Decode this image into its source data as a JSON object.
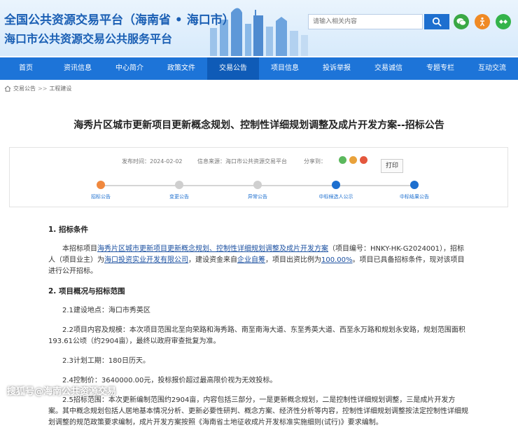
{
  "header": {
    "title_line1": "全国公共资源交易平台（海南省 • 海口市）",
    "title_line2": "海口市公共资源交易公共服务平台",
    "search_placeholder": "请输入相关内容"
  },
  "nav": {
    "items": [
      "首页",
      "资讯信息",
      "中心简介",
      "政策文件",
      "交易公告",
      "项目信息",
      "投诉举报",
      "交易诚信",
      "专题专栏",
      "互动交流"
    ],
    "active_index": 4
  },
  "breadcrumb": {
    "items": [
      "交易公告",
      "工程建设"
    ],
    "separator": ">>"
  },
  "article": {
    "title": "海秀片区城市更新项目更新概念规划、控制性详细规划调整及成片开发方案--招标公告",
    "publish_label": "发布时间：",
    "publish_date": "2024-02-02",
    "source_label": "信息来源：",
    "source": "海口市公共资源交易平台",
    "share_label": "分享到：",
    "print_label": "打印"
  },
  "progress": {
    "steps": [
      {
        "label": "招标公告",
        "state": "current"
      },
      {
        "label": "变更公告",
        "state": "pending"
      },
      {
        "label": "异常公告",
        "state": "pending"
      },
      {
        "label": "中标候选人公示",
        "state": "done"
      },
      {
        "label": "中标结果公告",
        "state": "done"
      }
    ]
  },
  "content": {
    "sec1_title": "1. 招标条件",
    "sec1_p1_a": "本招标项目",
    "sec1_p1_project": "海秀片区城市更新项目更新概念规划、控制性详细规划调整及成片开发方案",
    "sec1_p1_b": "（项目编号：HNKY-HK-G2024001），招标人（项目业主）为",
    "sec1_p1_owner": "海口投资实业开发有限公司",
    "sec1_p1_c": "，建设资金来自",
    "sec1_p1_fund": "企业自筹",
    "sec1_p1_d": "，项目出资比例为",
    "sec1_p1_ratio": "100.00%",
    "sec1_p1_e": "。项目已具备招标条件，现对该项目进行公开招标。",
    "sec2_title": "2. 项目概况与招标范围",
    "sec2_p1": "2.1建设地点：海口市秀英区",
    "sec2_p2": "2.2项目内容及规模：本次项目范围北至向荣路和海秀路、南至南海大道、东至秀英大道、西至永万路和规划永安路，规划范围面积193.61公顷（约2904亩），最终以政府审查批复为准。",
    "sec2_p3": "2.3计划工期：180日历天。",
    "sec2_p4": "2.4控制价：3640000.00元，投标报价超过最高限价视为无效投标。",
    "sec2_p5": "2.5招标范围：本次更新编制范围约2904亩，内容包括三部分，一是更新概念规划，二是控制性详细规划调整，三是成片开发方案。其中概念规划包括人居地基本情况分析、更新必要性研判、概念方案、经济性分析等内容，控制性详细规划调整按法定控制性详细规划调整的规范政策要求编制，成片开发方案按照《海南省土地征收成片开发标准实施细则(试行)》要求编制。"
  },
  "watermark": "搜狐号@海南公共资源交易",
  "colors": {
    "brand_blue": "#1d74d8",
    "nav_active": "#0f5bb7",
    "step_current": "#f0883e",
    "step_done": "#1d6fcf",
    "step_pending": "#cfcfcf"
  }
}
